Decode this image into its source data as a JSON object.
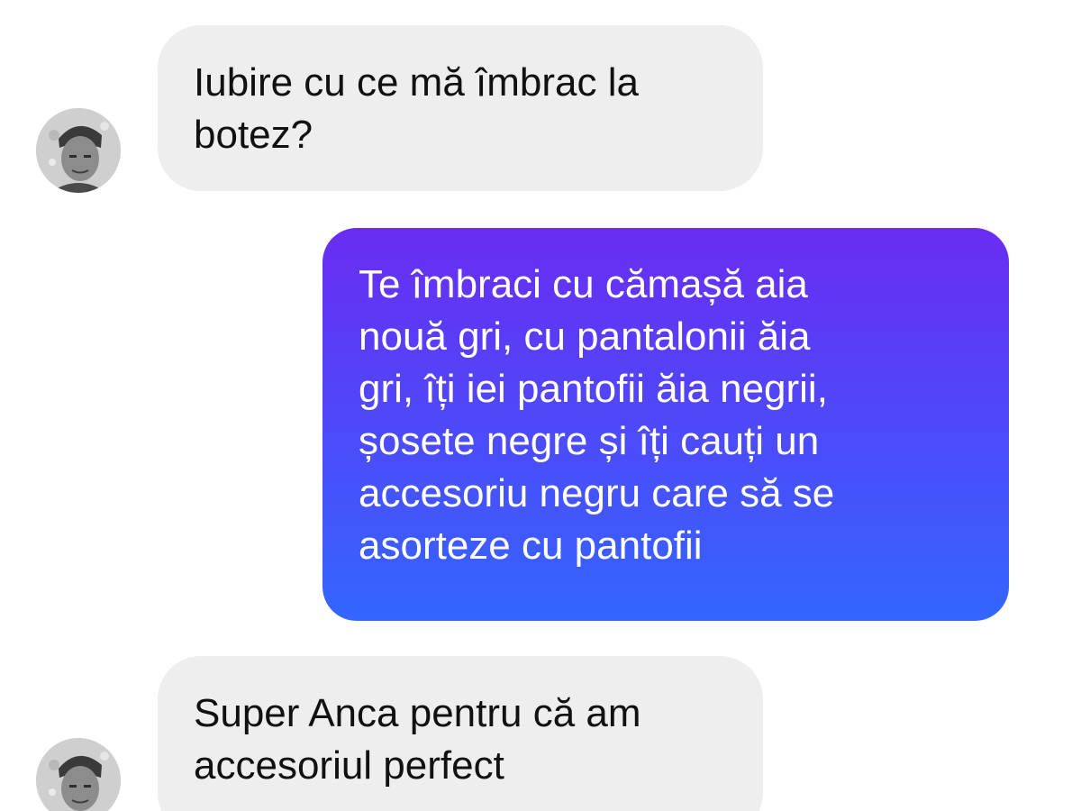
{
  "conversation": {
    "messages": [
      {
        "sender": "contact",
        "text": "Iubire cu ce mă îmbrac la\nbotez?"
      },
      {
        "sender": "me",
        "text": "Te îmbraci cu cămașă aia\nnouă gri, cu pantalonii ăia\ngri, îți iei pantofii ăia negrii,\nșosete negre și îți cauți un\naccesoriu negru care să se\nasorteze cu pantofii"
      },
      {
        "sender": "contact",
        "text": "Super Anca pentru că am\naccesoriul perfect"
      }
    ]
  },
  "colors": {
    "incoming_bubble": "#eeeeef",
    "outgoing_gradient_top": "#6a2cf2",
    "outgoing_gradient_bottom": "#3366ff",
    "outgoing_text": "#ffffff",
    "incoming_text": "#111111"
  },
  "icons": {
    "contact_avatar": "profile-photo-icon"
  }
}
